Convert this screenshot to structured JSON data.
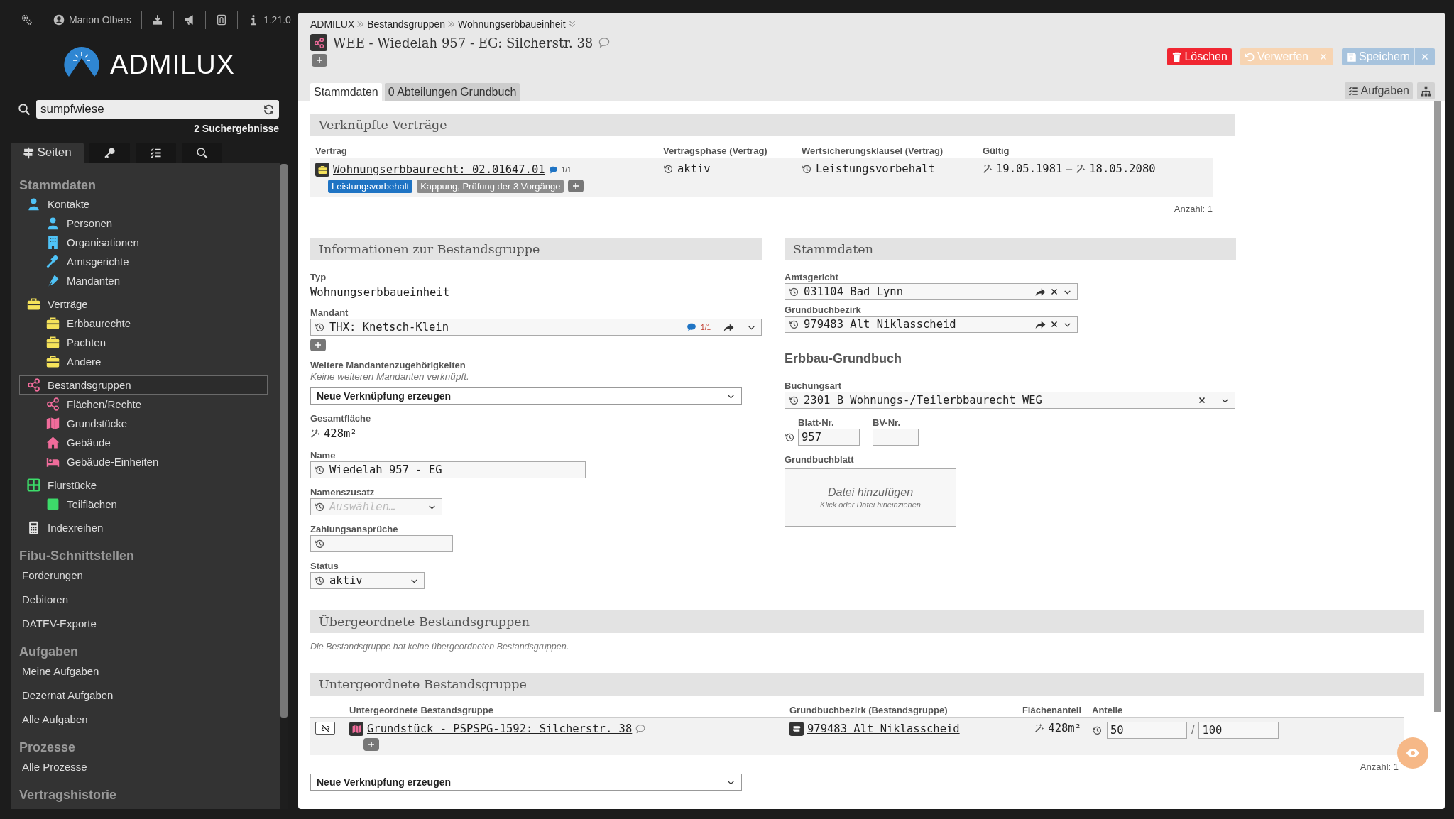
{
  "toolbar": [
    {
      "kind": "gears"
    },
    {
      "kind": "user",
      "label": "Marion Olbers"
    },
    {
      "kind": "download"
    },
    {
      "kind": "megaphone"
    },
    {
      "kind": "document"
    },
    {
      "kind": "info",
      "label": "1.21.0"
    }
  ],
  "logo": {
    "text": "ADMILUX"
  },
  "search": {
    "value": "sumpfwiese",
    "results": "2 Suchergebnisse"
  },
  "sidebar_tabs": [
    {
      "kind": "signs",
      "label": "Seiten",
      "selected": true
    },
    {
      "kind": "key",
      "selected": false
    },
    {
      "kind": "checklist",
      "selected": false
    },
    {
      "kind": "search",
      "selected": false
    }
  ],
  "nav_sections": [
    {
      "title": "Stammdaten",
      "items": [
        {
          "label": "Kontakte",
          "kind": "person",
          "color": "#4fc3f7",
          "selected": false,
          "children": [
            {
              "label": "Personen",
              "kind": "person",
              "color": "#4fc3f7",
              "selected": false
            },
            {
              "label": "Organisationen",
              "kind": "building",
              "color": "#4fc3f7",
              "selected": false
            },
            {
              "label": "Amtsgerichte",
              "kind": "gavel",
              "color": "#4fc3f7",
              "selected": false
            },
            {
              "label": "Mandanten",
              "kind": "pen",
              "color": "#4fc3f7",
              "selected": false
            }
          ]
        },
        {
          "label": "Verträge",
          "kind": "briefcase",
          "color": "#f5e25a",
          "selected": false,
          "children": [
            {
              "label": "Erbbaurechte",
              "kind": "briefcase",
              "color": "#f5e25a",
              "selected": false
            },
            {
              "label": "Pachten",
              "kind": "briefcase",
              "color": "#f5e25a",
              "selected": false
            },
            {
              "label": "Andere",
              "kind": "briefcase",
              "color": "#f5e25a",
              "selected": false
            }
          ]
        },
        {
          "label": "Bestandsgruppen",
          "kind": "share",
          "color": "#f06c9b",
          "selected": true,
          "children": [
            {
              "label": "Flächen/Rechte",
              "kind": "share",
              "color": "#f06c9b",
              "selected": false
            },
            {
              "label": "Grundstücke",
              "kind": "map",
              "color": "#f06c9b",
              "selected": false
            },
            {
              "label": "Gebäude",
              "kind": "house",
              "color": "#f06c9b",
              "selected": false
            },
            {
              "label": "Gebäude-Einheiten",
              "kind": "bed",
              "color": "#f06c9b",
              "selected": false
            }
          ]
        },
        {
          "label": "Flurstücke",
          "kind": "grid",
          "color": "#3ddc6a",
          "selected": false,
          "children": [
            {
              "label": "Teilflächen",
              "kind": "square",
              "color": "#3ddc6a",
              "selected": false
            }
          ]
        },
        {
          "label": "Indexreihen",
          "kind": "calculator",
          "color": "#e6e6e6",
          "selected": false
        }
      ]
    },
    {
      "title": "Fibu-Schnittstellen",
      "items": [
        {
          "label": "Forderungen",
          "selected": false
        },
        {
          "label": "Debitoren",
          "selected": false
        },
        {
          "label": "DATEV-Exporte",
          "selected": false
        }
      ]
    },
    {
      "title": "Aufgaben",
      "items": [
        {
          "label": "Meine Aufgaben",
          "selected": false
        },
        {
          "label": "Dezernat Aufgaben",
          "selected": false
        },
        {
          "label": "Alle Aufgaben",
          "selected": false
        }
      ]
    },
    {
      "title": "Prozesse",
      "items": [
        {
          "label": "Alle Prozesse",
          "selected": false
        }
      ]
    },
    {
      "title": "Vertragshistorie"
    }
  ],
  "breadcrumb": [
    "ADMILUX",
    "Bestandsgruppen",
    "Wohnungserbbaueinheit"
  ],
  "title": "WEE - Wiedelah 957 - EG: Silcherstr. 38",
  "actions": [
    {
      "label": "Löschen",
      "kind": "delete",
      "disabled": false
    },
    {
      "label": "Verwerfen",
      "kind": "discard",
      "disabled": true
    },
    {
      "label": "Speichern",
      "kind": "save",
      "disabled": true
    }
  ],
  "tabs": [
    {
      "label": "Stammdaten",
      "selected": true
    },
    {
      "label": "0 Abteilungen Grundbuch",
      "selected": false
    }
  ],
  "tasks_button": "Aufgaben",
  "linked_contracts": {
    "title": "Verknüpfte Verträge",
    "columns": [
      "Vertrag",
      "Vertragsphase (Vertrag)",
      "Wertsicherungsklausel (Vertrag)",
      "Gültig"
    ],
    "rows": [
      {
        "contract": "Wohnungserbbaurecht: 02.01647.01",
        "comments": "1/1",
        "phase": "aktiv",
        "clause": "Leistungsvorbehalt",
        "valid_from": "19.05.1981",
        "separator": "–",
        "valid_to": "18.05.2080",
        "tags": [
          {
            "label": "Leistungsvorbehalt",
            "color": "#1f74c4"
          },
          {
            "label": "Kappung, Prüfung der 3 Vorgänge",
            "color": "#8c8c8c"
          }
        ]
      }
    ],
    "count": "Anzahl: 1"
  },
  "info": {
    "title": "Informationen zur Bestandsgruppe",
    "type_label": "Typ",
    "type_value": "Wohnungserbbaueinheit",
    "mandant_label": "Mandant",
    "mandant_value": "THX: Knetsch-Klein",
    "mandant_comments": "1/1",
    "more_label": "Weitere Mandantenzugehörigkeiten",
    "more_note": "Keine weiteren Mandanten verknüpft.",
    "more_select": "Neue Verknüpfung erzeugen",
    "area_label": "Gesamtfläche",
    "area_value": "428m²",
    "name_label": "Name",
    "name_value": "Wiedelah 957 - EG",
    "suffix_label": "Namenszusatz",
    "suffix_placeholder": "Auswählen…",
    "payments_label": "Zahlungsansprüche",
    "status_label": "Status",
    "status_value": "aktiv"
  },
  "master": {
    "title": "Stammdaten",
    "court_label": "Amtsgericht",
    "court_value": "031104 Bad Lynn",
    "district_label": "Grundbuchbezirk",
    "district_value": "979483 Alt Niklasscheid",
    "subheading": "Erbbau-Grundbuch",
    "booking_label": "Buchungsart",
    "booking_value": "2301 B Wohnungs-/Teilerbbaurecht WEG",
    "sheet_label": "Blatt-Nr.",
    "sheet_value": "957",
    "bv_label": "BV-Nr.",
    "file_label": "Grundbuchblatt",
    "drop_title": "Datei hinzufügen",
    "drop_hint": "Klick oder Datei hineinziehen"
  },
  "parents": {
    "title": "Übergeordnete Bestandsgruppen",
    "note": "Die Bestandsgruppe hat keine übergeordneten Bestandsgruppen."
  },
  "children": {
    "title": "Untergeordnete Bestandsgruppe",
    "columns": [
      "Untergeordnete Bestandsgruppe",
      "Grundbuchbezirk (Bestandsgruppe)",
      "Flächenanteil",
      "Anteile"
    ],
    "rows": [
      {
        "name": "Grundstück - PSPSPG-1592: Silcherstr. 38",
        "district": "979483 Alt Niklasscheid",
        "area": "428m²",
        "share": "50",
        "share_separator": "/",
        "total": "100"
      }
    ],
    "count": "Anzahl: 1",
    "select": "Neue Verknüpfung erzeugen"
  }
}
